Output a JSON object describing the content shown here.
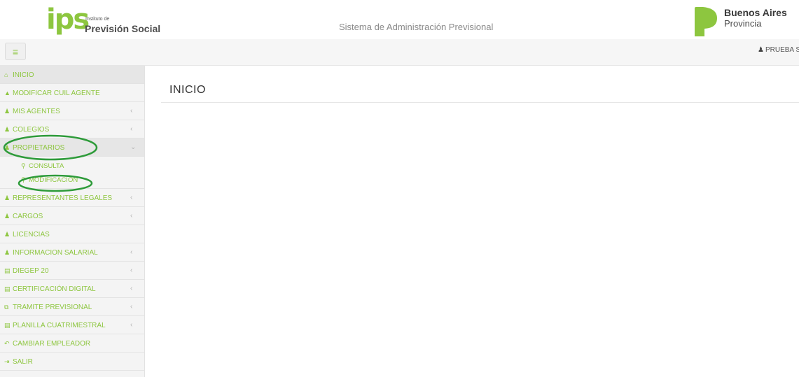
{
  "header": {
    "logo_text": "ips",
    "logo_small": "Instituto de",
    "logo_big": "Previsión Social",
    "app_title": "Sistema de Administración Previsional",
    "province_line1": "Buenos Aires",
    "province_line2": "Provincia"
  },
  "toolbar": {
    "toggle_icon": "≡",
    "user_name": "PRUEBA SA"
  },
  "sidebar": {
    "items": [
      {
        "label": "INICIO",
        "icon": "⌂"
      },
      {
        "label": "MODIFICAR CUIL AGENTE",
        "icon": "▲"
      },
      {
        "label": "MIS AGENTES",
        "icon": "♟",
        "chevron": "‹"
      },
      {
        "label": "COLEGIOS",
        "icon": "♟",
        "chevron": "‹"
      },
      {
        "label": "PROPIETARIOS",
        "icon": "♟",
        "chevron": "⌄"
      },
      {
        "label": "REPRESENTANTES LEGALES",
        "icon": "♟",
        "chevron": "‹"
      },
      {
        "label": "CARGOS",
        "icon": "♟",
        "chevron": "‹"
      },
      {
        "label": "LICENCIAS",
        "icon": "♟"
      },
      {
        "label": "INFORMACION SALARIAL",
        "icon": "♟",
        "chevron": "‹"
      },
      {
        "label": "DIEGEP 20",
        "icon": "▤",
        "chevron": "‹"
      },
      {
        "label": "CERTIFICACIÓN DIGITAL",
        "icon": "▤",
        "chevron": "‹"
      },
      {
        "label": "TRAMITE PREVISIONAL",
        "icon": "⧉",
        "chevron": "‹"
      },
      {
        "label": "PLANILLA CUATRIMESTRAL",
        "icon": "▤",
        "chevron": "‹"
      },
      {
        "label": "CAMBIAR EMPLEADOR",
        "icon": "↶"
      },
      {
        "label": "SALIR",
        "icon": "⇥"
      }
    ],
    "propietarios_sub": [
      {
        "label": "CONSULTA",
        "icon": "⚲"
      },
      {
        "label": "MODIFICACIÓN",
        "icon": "⚲"
      }
    ]
  },
  "main": {
    "title": "INICIO"
  },
  "colors": {
    "accent": "#8dc63f",
    "annotation": "#2e9b3a"
  }
}
